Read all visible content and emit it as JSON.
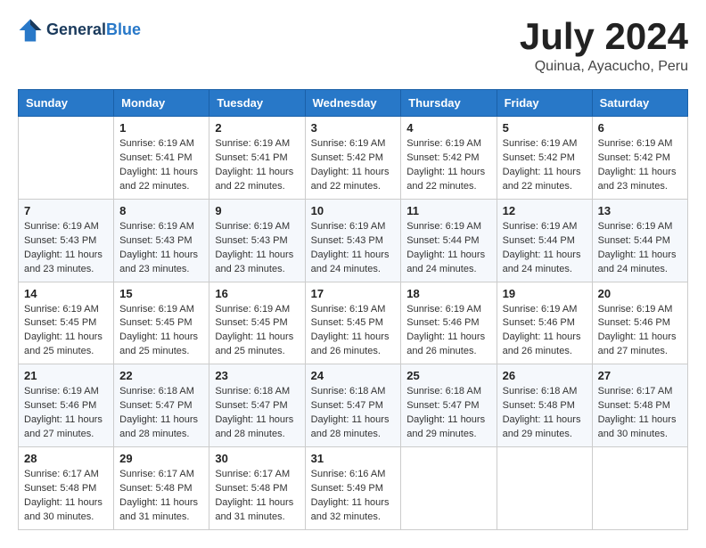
{
  "header": {
    "logo_line1": "General",
    "logo_line2": "Blue",
    "month_title": "July 2024",
    "location": "Quinua, Ayacucho, Peru"
  },
  "days_of_week": [
    "Sunday",
    "Monday",
    "Tuesday",
    "Wednesday",
    "Thursday",
    "Friday",
    "Saturday"
  ],
  "weeks": [
    [
      {
        "day": "",
        "info": ""
      },
      {
        "day": "1",
        "info": "Sunrise: 6:19 AM\nSunset: 5:41 PM\nDaylight: 11 hours\nand 22 minutes."
      },
      {
        "day": "2",
        "info": "Sunrise: 6:19 AM\nSunset: 5:41 PM\nDaylight: 11 hours\nand 22 minutes."
      },
      {
        "day": "3",
        "info": "Sunrise: 6:19 AM\nSunset: 5:42 PM\nDaylight: 11 hours\nand 22 minutes."
      },
      {
        "day": "4",
        "info": "Sunrise: 6:19 AM\nSunset: 5:42 PM\nDaylight: 11 hours\nand 22 minutes."
      },
      {
        "day": "5",
        "info": "Sunrise: 6:19 AM\nSunset: 5:42 PM\nDaylight: 11 hours\nand 22 minutes."
      },
      {
        "day": "6",
        "info": "Sunrise: 6:19 AM\nSunset: 5:42 PM\nDaylight: 11 hours\nand 23 minutes."
      }
    ],
    [
      {
        "day": "7",
        "info": "Sunrise: 6:19 AM\nSunset: 5:43 PM\nDaylight: 11 hours\nand 23 minutes."
      },
      {
        "day": "8",
        "info": "Sunrise: 6:19 AM\nSunset: 5:43 PM\nDaylight: 11 hours\nand 23 minutes."
      },
      {
        "day": "9",
        "info": "Sunrise: 6:19 AM\nSunset: 5:43 PM\nDaylight: 11 hours\nand 23 minutes."
      },
      {
        "day": "10",
        "info": "Sunrise: 6:19 AM\nSunset: 5:43 PM\nDaylight: 11 hours\nand 24 minutes."
      },
      {
        "day": "11",
        "info": "Sunrise: 6:19 AM\nSunset: 5:44 PM\nDaylight: 11 hours\nand 24 minutes."
      },
      {
        "day": "12",
        "info": "Sunrise: 6:19 AM\nSunset: 5:44 PM\nDaylight: 11 hours\nand 24 minutes."
      },
      {
        "day": "13",
        "info": "Sunrise: 6:19 AM\nSunset: 5:44 PM\nDaylight: 11 hours\nand 24 minutes."
      }
    ],
    [
      {
        "day": "14",
        "info": "Sunrise: 6:19 AM\nSunset: 5:45 PM\nDaylight: 11 hours\nand 25 minutes."
      },
      {
        "day": "15",
        "info": "Sunrise: 6:19 AM\nSunset: 5:45 PM\nDaylight: 11 hours\nand 25 minutes."
      },
      {
        "day": "16",
        "info": "Sunrise: 6:19 AM\nSunset: 5:45 PM\nDaylight: 11 hours\nand 25 minutes."
      },
      {
        "day": "17",
        "info": "Sunrise: 6:19 AM\nSunset: 5:45 PM\nDaylight: 11 hours\nand 26 minutes."
      },
      {
        "day": "18",
        "info": "Sunrise: 6:19 AM\nSunset: 5:46 PM\nDaylight: 11 hours\nand 26 minutes."
      },
      {
        "day": "19",
        "info": "Sunrise: 6:19 AM\nSunset: 5:46 PM\nDaylight: 11 hours\nand 26 minutes."
      },
      {
        "day": "20",
        "info": "Sunrise: 6:19 AM\nSunset: 5:46 PM\nDaylight: 11 hours\nand 27 minutes."
      }
    ],
    [
      {
        "day": "21",
        "info": "Sunrise: 6:19 AM\nSunset: 5:46 PM\nDaylight: 11 hours\nand 27 minutes."
      },
      {
        "day": "22",
        "info": "Sunrise: 6:18 AM\nSunset: 5:47 PM\nDaylight: 11 hours\nand 28 minutes."
      },
      {
        "day": "23",
        "info": "Sunrise: 6:18 AM\nSunset: 5:47 PM\nDaylight: 11 hours\nand 28 minutes."
      },
      {
        "day": "24",
        "info": "Sunrise: 6:18 AM\nSunset: 5:47 PM\nDaylight: 11 hours\nand 28 minutes."
      },
      {
        "day": "25",
        "info": "Sunrise: 6:18 AM\nSunset: 5:47 PM\nDaylight: 11 hours\nand 29 minutes."
      },
      {
        "day": "26",
        "info": "Sunrise: 6:18 AM\nSunset: 5:48 PM\nDaylight: 11 hours\nand 29 minutes."
      },
      {
        "day": "27",
        "info": "Sunrise: 6:17 AM\nSunset: 5:48 PM\nDaylight: 11 hours\nand 30 minutes."
      }
    ],
    [
      {
        "day": "28",
        "info": "Sunrise: 6:17 AM\nSunset: 5:48 PM\nDaylight: 11 hours\nand 30 minutes."
      },
      {
        "day": "29",
        "info": "Sunrise: 6:17 AM\nSunset: 5:48 PM\nDaylight: 11 hours\nand 31 minutes."
      },
      {
        "day": "30",
        "info": "Sunrise: 6:17 AM\nSunset: 5:48 PM\nDaylight: 11 hours\nand 31 minutes."
      },
      {
        "day": "31",
        "info": "Sunrise: 6:16 AM\nSunset: 5:49 PM\nDaylight: 11 hours\nand 32 minutes."
      },
      {
        "day": "",
        "info": ""
      },
      {
        "day": "",
        "info": ""
      },
      {
        "day": "",
        "info": ""
      }
    ]
  ]
}
